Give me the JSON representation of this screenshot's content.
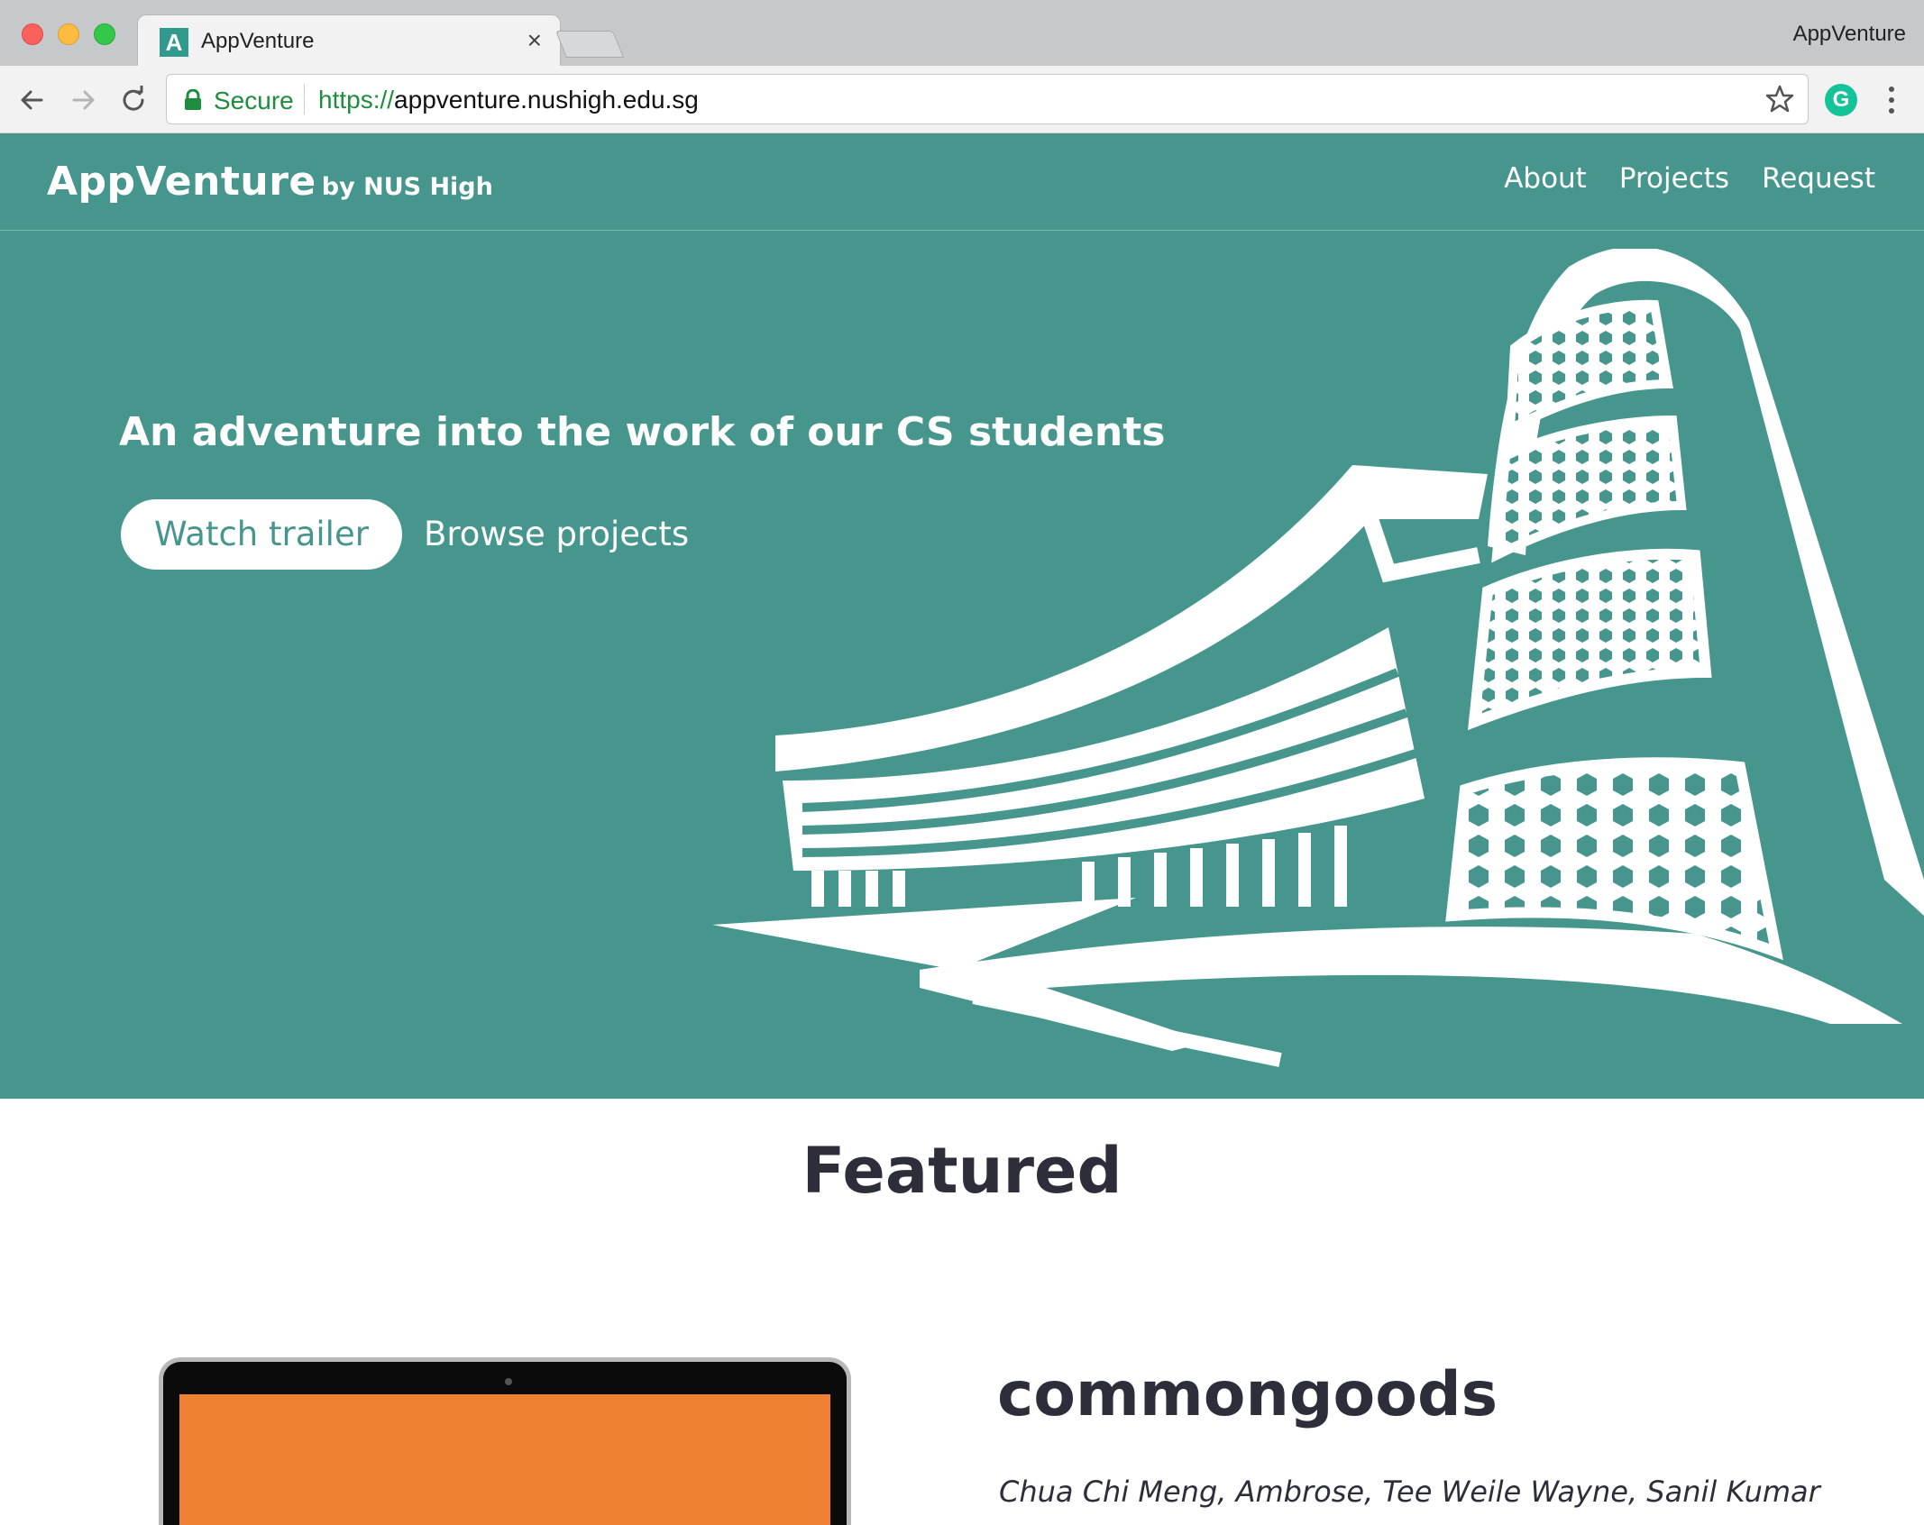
{
  "browser": {
    "tab_title": "AppVenture",
    "favicon_letter": "A",
    "tab_close": "×",
    "profile_name": "AppVenture",
    "secure_label": "Secure",
    "url_scheme": "https://",
    "url_host": "appventure.nushigh.edu.sg",
    "extension_letter": "G"
  },
  "header": {
    "brand_name": "AppVenture",
    "brand_sub": "by NUS High",
    "nav": [
      {
        "label": "About"
      },
      {
        "label": "Projects"
      },
      {
        "label": "Request"
      }
    ]
  },
  "hero": {
    "title": "An adventure into the work of our CS students",
    "primary_button": "Watch trailer",
    "secondary_button": "Browse projects"
  },
  "featured": {
    "heading": "Featured",
    "project": {
      "name": "commongoods",
      "authors": "Chua Chi Meng, Ambrose, Tee Weile Wayne, Sanil Kumar"
    }
  },
  "colors": {
    "brand_teal": "#46968d",
    "text_dark": "#2c2f3a",
    "screen_orange": "#ef8133",
    "secure_green": "#1e8e3e"
  },
  "icons": [
    "back-arrow-icon",
    "forward-arrow-icon",
    "reload-icon",
    "lock-icon",
    "star-icon",
    "grammarly-icon",
    "menu-dots-icon",
    "building-illustration"
  ]
}
